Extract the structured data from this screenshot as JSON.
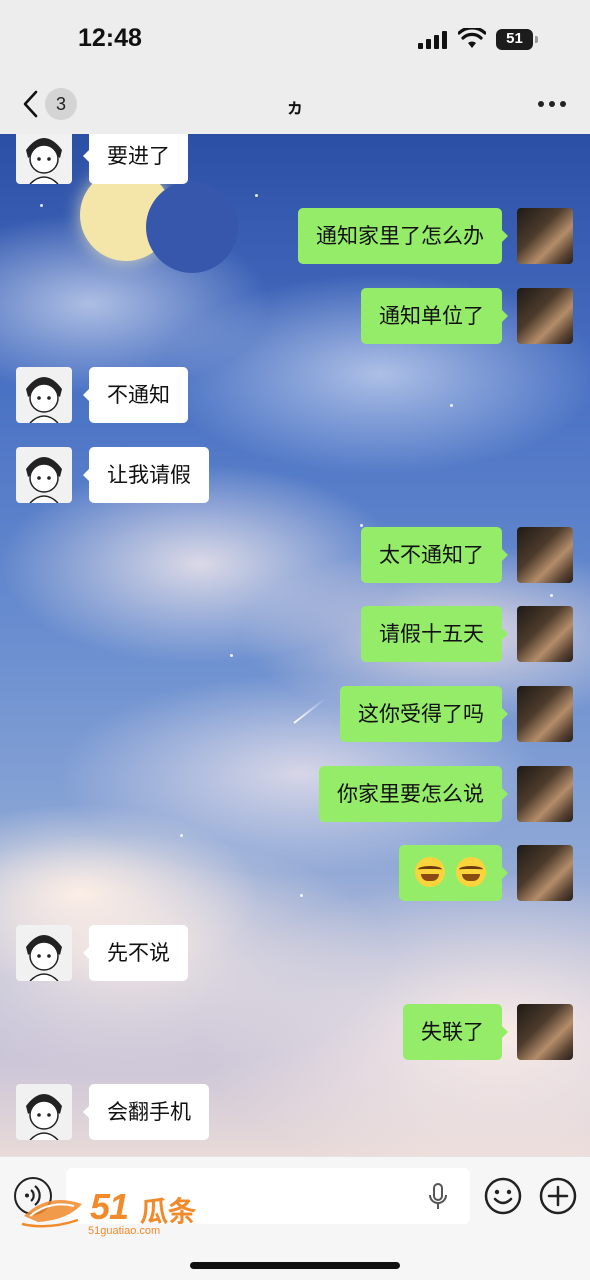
{
  "status_bar": {
    "time": "12:48",
    "battery": "51"
  },
  "nav": {
    "unread_count": "3",
    "title": "ヵ"
  },
  "messages": [
    {
      "side": "in",
      "text": "要进了"
    },
    {
      "side": "out",
      "text": "通知家里了怎么办"
    },
    {
      "side": "out",
      "text": "通知单位了"
    },
    {
      "side": "in",
      "text": "不通知"
    },
    {
      "side": "in",
      "text": "让我请假"
    },
    {
      "side": "out",
      "text": "太不通知了"
    },
    {
      "side": "out",
      "text": "请假十五天"
    },
    {
      "side": "out",
      "text": "这你受得了吗"
    },
    {
      "side": "out",
      "text": "你家里要怎么说"
    },
    {
      "side": "out",
      "emoji": [
        "laughing-crying-emoji",
        "laughing-crying-emoji"
      ]
    },
    {
      "side": "in",
      "text": "先不说"
    },
    {
      "side": "out",
      "text": "失联了"
    },
    {
      "side": "in",
      "text": "会翻手机"
    }
  ],
  "input_bar": {
    "placeholder": ""
  },
  "watermark": {
    "brand_number": "51",
    "brand_name": "瓜条",
    "url": "51guatiao.com"
  },
  "colors": {
    "outgoing_bubble": "#95ec69",
    "incoming_bubble": "#ffffff",
    "watermark": "#f08a2b"
  }
}
